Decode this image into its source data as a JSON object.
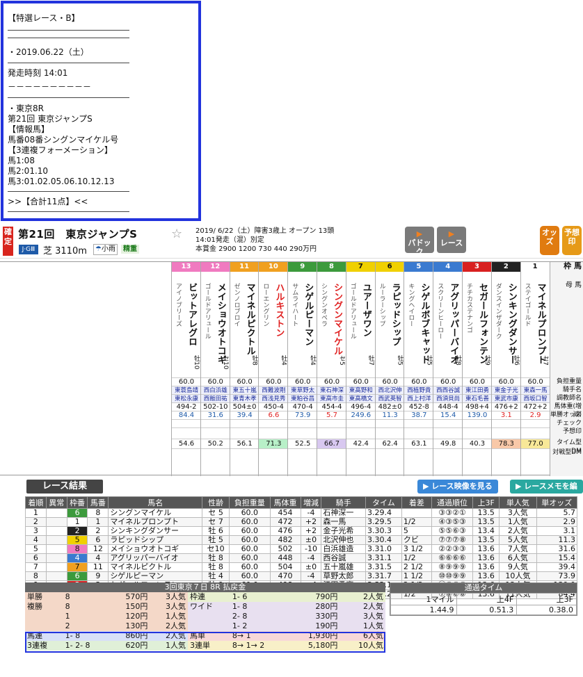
{
  "memo": {
    "lines": [
      "【特選レース・B】",
      "・2019.06.22（土）",
      "発走時刻 14:01",
      "－－－－－－－－－－",
      "・東京8R",
      "第21回 東京ジャンプS",
      "【情報馬】",
      "馬番08番シングンマイケル号",
      "【3連複フォーメーション】",
      "馬1:08",
      "馬2:01.10",
      "馬3:01.02.05.06.10.12.13",
      ">>【合計11点】<<"
    ]
  },
  "header": {
    "kakutei": "確定",
    "title": "第21回　東京ジャンプS",
    "grade": "J·GⅢ",
    "course": "芝 3110m",
    "weather": "小雨",
    "baba": "精重",
    "info1": "2019/ 6/22（土）障害3歳上 オープン 13頭",
    "info2": "14:01発走（混）別定",
    "info3": "本賞金 2900 1200 730 440 290万円",
    "paddock": "パドック",
    "race": "レース",
    "odds": "オッズ",
    "yoso": "予想印"
  },
  "card": {
    "horses": [
      {
        "waku": "8",
        "uma": "13",
        "name": "ビットアレグロ",
        "sire": "アイノブリーズ",
        "sex": "牡10",
        "kg": "60.0",
        "jockey": "東蓑島靖",
        "trainer": "東松永康",
        "wt": "494-2",
        "odds": "84.4",
        "time": "54.6",
        "color": "#f07ac0"
      },
      {
        "waku": "8",
        "uma": "12",
        "name": "メイショウオトコギ",
        "sire": "ゴールドアリュール",
        "sex": "セ10",
        "kg": "60.0",
        "jockey": "西白浜雄",
        "trainer": "西飯田祐",
        "wt": "502-10",
        "odds": "31.6",
        "time": "50.2",
        "color": "#f07ac0"
      },
      {
        "waku": "7",
        "uma": "11",
        "name": "マイネルピクトル",
        "sire": "ゼンノロブロイ",
        "sex": "牡8",
        "kg": "60.0",
        "jockey": "東五十嵐",
        "trainer": "東青木孝",
        "wt": "504±0",
        "odds": "39.4",
        "time": "56.1",
        "color": "#f0a020"
      },
      {
        "waku": "7",
        "uma": "10",
        "name": "ハルキストン",
        "sire": "ローエングリン",
        "sex": "牡4",
        "kg": "60.0",
        "jockey": "西難波剛",
        "trainer": "西浅見秀",
        "wt": "450-4",
        "odds": "6.6",
        "time": "71.3",
        "color": "#f0a020"
      },
      {
        "waku": "6",
        "uma": "9",
        "name": "シゲルピーマン",
        "sire": "サムライハート",
        "sex": "牡4",
        "kg": "60.0",
        "jockey": "東草野太",
        "trainer": "東粕谷昌",
        "wt": "470-4",
        "odds": "73.9",
        "time": "52.5",
        "color": "#3c9a3c"
      },
      {
        "waku": "6",
        "uma": "8",
        "name": "シングンマイケル",
        "sire": "シングンオペラ",
        "sex": "セ5",
        "kg": "60.0",
        "jockey": "東石神深",
        "trainer": "東高市圭",
        "wt": "454-4",
        "odds": "5.7",
        "time": "66.7",
        "color": "#3c9a3c"
      },
      {
        "waku": "5",
        "uma": "7",
        "name": "ユアーザワン",
        "sire": "ゴールドアリュール",
        "sex": "牡7",
        "kg": "60.0",
        "jockey": "東高野和",
        "trainer": "東高橋文",
        "wt": "496-4",
        "odds": "249.6",
        "time": "42.4",
        "color": "#f0d000"
      },
      {
        "waku": "5",
        "uma": "6",
        "name": "ラピッドシップ",
        "sire": "ルーラーシップ",
        "sex": "牡5",
        "kg": "60.0",
        "jockey": "西北沢伸",
        "trainer": "西武英智",
        "wt": "482±0",
        "odds": "11.3",
        "time": "62.4",
        "color": "#f0d000"
      },
      {
        "waku": "4",
        "uma": "5",
        "name": "シゲルボブキャット",
        "sire": "キングヘイロー",
        "sex": "牡5",
        "kg": "60.0",
        "jockey": "西植野貴",
        "trainer": "西上村洋",
        "wt": "452-8",
        "odds": "38.7",
        "time": "63.1",
        "color": "#3a7ad0"
      },
      {
        "waku": "4",
        "uma": "4",
        "name": "アグリッパーバイオ",
        "sire": "スクリーンヒーロー",
        "sex": "牡8",
        "kg": "60.0",
        "jockey": "西西谷誠",
        "trainer": "西須貝尚",
        "wt": "448-4",
        "odds": "15.4",
        "time": "49.8",
        "color": "#3a7ad0"
      },
      {
        "waku": "3",
        "uma": "3",
        "name": "セガールフォンテン",
        "sire": "チチカステナンゴ",
        "sex": "牡9",
        "kg": "60.0",
        "jockey": "東江田勇",
        "trainer": "東石毛善",
        "wt": "498+4",
        "odds": "139.0",
        "time": "40.3",
        "color": "#d82020"
      },
      {
        "waku": "2",
        "uma": "2",
        "name": "シンキングダンサー",
        "sire": "ダンスインザダーク",
        "sex": "牡6",
        "kg": "60.0",
        "jockey": "東金子光",
        "trainer": "東武市康",
        "wt": "476+2",
        "odds": "3.1",
        "time": "78.3",
        "color": "#222222"
      },
      {
        "waku": "1",
        "uma": "1",
        "name": "マイネルプロンプト",
        "sire": "ステイゴールド",
        "sex": "セ7",
        "kg": "60.0",
        "jockey": "東森一馬",
        "trainer": "西坂口智",
        "wt": "472+2",
        "odds": "2.9",
        "time": "77.0",
        "color": "#ffffff"
      }
    ],
    "labels": [
      "枠 馬",
      "母 馬",
      "負担重量",
      "騎手名",
      "調教師名",
      "馬体重(増減)",
      "単勝オッズ",
      "チェック",
      "予想印",
      "タイム型DM",
      "対戦型DM"
    ]
  },
  "results": {
    "title": "レース結果",
    "video": "レース映像を見る",
    "memo": "レースメモを編集",
    "headers": [
      "着順",
      "異常",
      "枠番",
      "馬番",
      "馬名",
      "性齢",
      "負担重量",
      "馬体重",
      "増減",
      "騎手",
      "タイム",
      "着差",
      "通過順位",
      "上3F",
      "単人気",
      "単オッズ"
    ],
    "rows": [
      [
        "1",
        "",
        "6",
        "8",
        "シングンマイケル",
        "セ 5",
        "60.0",
        "454",
        "-4",
        "石神深一",
        "3.29.4",
        "",
        "③③②①",
        "13.5",
        "3人気",
        "5.7"
      ],
      [
        "2",
        "",
        "1",
        "1",
        "マイネルプロンプト",
        "セ 7",
        "60.0",
        "472",
        "+2",
        "森一馬",
        "3.29.5",
        "1/2",
        "④③⑤③",
        "13.5",
        "1人気",
        "2.9"
      ],
      [
        "3",
        "",
        "2",
        "2",
        "シンキングダンサー",
        "牡 6",
        "60.0",
        "476",
        "+2",
        "金子光希",
        "3.30.3",
        "5",
        "⑤⑤⑥③",
        "13.4",
        "2人気",
        "3.1"
      ],
      [
        "4",
        "",
        "5",
        "6",
        "ラピッドシップ",
        "牡 5",
        "60.0",
        "482",
        "±0",
        "北沢伸也",
        "3.30.4",
        "クビ",
        "⑦⑦⑦⑧",
        "13.5",
        "5人気",
        "11.3"
      ],
      [
        "5",
        "",
        "8",
        "12",
        "メイショウオトコギ",
        "セ10",
        "60.0",
        "502",
        "-10",
        "白浜雄造",
        "3.31.0",
        "3 1/2",
        "②②③③",
        "13.6",
        "7人気",
        "31.6"
      ],
      [
        "6",
        "",
        "4",
        "4",
        "アグリッパーバイオ",
        "牡 8",
        "60.0",
        "448",
        "-4",
        "西谷誠",
        "3.31.1",
        "1/2",
        "⑥⑥⑥⑥",
        "13.6",
        "6人気",
        "15.4"
      ],
      [
        "7",
        "",
        "7",
        "11",
        "マイネルピクトル",
        "牡 8",
        "60.0",
        "504",
        "±0",
        "五十嵐雄",
        "3.31.5",
        "2 1/2",
        "⑧⑨⑨⑨",
        "13.6",
        "9人気",
        "39.4"
      ],
      [
        "8",
        "",
        "6",
        "9",
        "シゲルピーマン",
        "牡 4",
        "60.0",
        "470",
        "-4",
        "草野太郎",
        "3.31.7",
        "1 1/2",
        "⑩⑩⑨⑨",
        "13.6",
        "10人気",
        "73.9"
      ],
      [
        "9",
        "",
        "3",
        "3",
        "セガールフォンテン",
        "牡 9",
        "60.0",
        "498",
        "+4",
        "江田勇亮",
        "3.32.1",
        "2 1/2",
        "⑪⑧③⑨",
        "13.6",
        "12人気",
        "139.0"
      ],
      [
        "10",
        "",
        "8",
        "13",
        "ビットアレグロ",
        "牡10",
        "60.0",
        "494",
        "-2",
        "蓑島靖典",
        "3.32.2",
        "1/2",
        "⑦⑧⑥⑧",
        "13.6",
        "11人気",
        "84.4"
      ]
    ]
  },
  "payout": {
    "title": "3回東京７日 8R 払戻金",
    "rows": [
      [
        "単勝",
        "8",
        "570円",
        "3人気",
        "枠連",
        "1- 6",
        "790円",
        "2人気"
      ],
      [
        "複勝",
        "8",
        "150円",
        "3人気",
        "ワイド",
        "1- 8",
        "280円",
        "2人気"
      ],
      [
        "",
        "1",
        "120円",
        "1人気",
        "",
        "2- 8",
        "330円",
        "3人気"
      ],
      [
        "",
        "2",
        "130円",
        "2人気",
        "",
        "1- 2",
        "190円",
        "1人気"
      ],
      [
        "馬連",
        "1- 8",
        "860円",
        "2人気",
        "馬単",
        "8→ 1",
        "1,930円",
        "6人気"
      ],
      [
        "3連複",
        "1- 2- 8",
        "620円",
        "1人気",
        "3連単",
        "8→ 1→ 2",
        "5,180円",
        "10人気"
      ]
    ]
  },
  "passtime": {
    "title": "通過タイム",
    "headers": [
      "1マイル",
      "上4F",
      "上3F"
    ],
    "values": [
      "1.44.9",
      "0.51.3",
      "0.38.0"
    ]
  }
}
